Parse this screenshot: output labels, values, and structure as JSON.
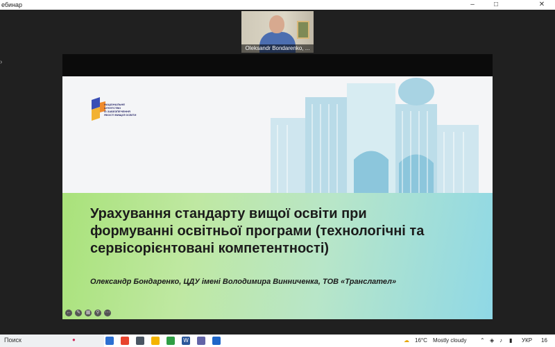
{
  "window": {
    "title": "ебинар"
  },
  "video": {
    "participant_name": "Oleksandr Bondarenko, ..."
  },
  "slide": {
    "logo_lines": "НАЦІОНАЛЬНЕ\nАГЕНТСТВО\nІЗ ЗАБЕЗПЕЧЕННЯ\nЯКОСТІ ВИЩОЇ ОСВІТИ",
    "title": "Урахування стандарту вищої освіти при формуванні освітньої програми (технологічні та сервісорієнтовані компетентності)",
    "author": "Олександр Бондаренко, ЦДУ імені Володимира Винниченка, ТОВ «Транслател»"
  },
  "taskbar": {
    "search_label": "Поиск",
    "temperature": "16°C",
    "weather": "Mostly cloudy",
    "language": "УКР",
    "clock": "16"
  },
  "colors": {
    "slide_gradient_start": "#a9e27a",
    "slide_gradient_end": "#8fd8e6",
    "background": "#202020"
  }
}
